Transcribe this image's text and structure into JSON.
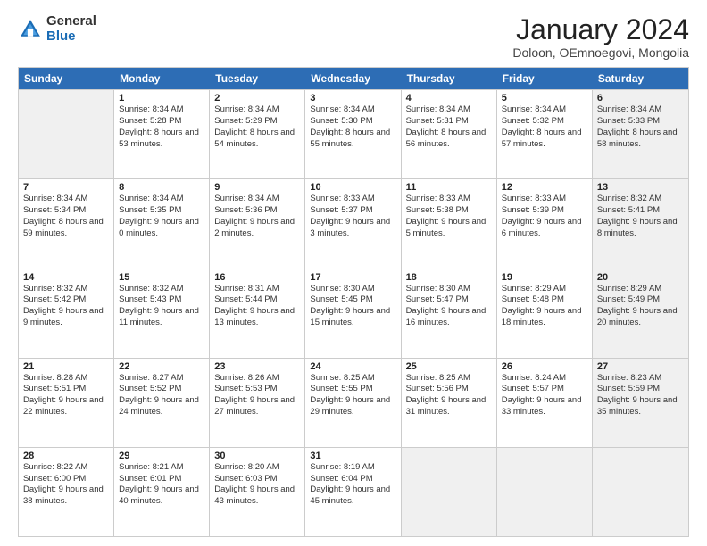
{
  "logo": {
    "general": "General",
    "blue": "Blue"
  },
  "header": {
    "month": "January 2024",
    "location": "Doloon, OEmnoegovi, Mongolia"
  },
  "weekdays": [
    "Sunday",
    "Monday",
    "Tuesday",
    "Wednesday",
    "Thursday",
    "Friday",
    "Saturday"
  ],
  "weeks": [
    [
      {
        "day": "",
        "sunrise": "",
        "sunset": "",
        "daylight": "",
        "shaded": true
      },
      {
        "day": "1",
        "sunrise": "Sunrise: 8:34 AM",
        "sunset": "Sunset: 5:28 PM",
        "daylight": "Daylight: 8 hours and 53 minutes.",
        "shaded": false
      },
      {
        "day": "2",
        "sunrise": "Sunrise: 8:34 AM",
        "sunset": "Sunset: 5:29 PM",
        "daylight": "Daylight: 8 hours and 54 minutes.",
        "shaded": false
      },
      {
        "day": "3",
        "sunrise": "Sunrise: 8:34 AM",
        "sunset": "Sunset: 5:30 PM",
        "daylight": "Daylight: 8 hours and 55 minutes.",
        "shaded": false
      },
      {
        "day": "4",
        "sunrise": "Sunrise: 8:34 AM",
        "sunset": "Sunset: 5:31 PM",
        "daylight": "Daylight: 8 hours and 56 minutes.",
        "shaded": false
      },
      {
        "day": "5",
        "sunrise": "Sunrise: 8:34 AM",
        "sunset": "Sunset: 5:32 PM",
        "daylight": "Daylight: 8 hours and 57 minutes.",
        "shaded": false
      },
      {
        "day": "6",
        "sunrise": "Sunrise: 8:34 AM",
        "sunset": "Sunset: 5:33 PM",
        "daylight": "Daylight: 8 hours and 58 minutes.",
        "shaded": true
      }
    ],
    [
      {
        "day": "7",
        "sunrise": "Sunrise: 8:34 AM",
        "sunset": "Sunset: 5:34 PM",
        "daylight": "Daylight: 8 hours and 59 minutes.",
        "shaded": false
      },
      {
        "day": "8",
        "sunrise": "Sunrise: 8:34 AM",
        "sunset": "Sunset: 5:35 PM",
        "daylight": "Daylight: 9 hours and 0 minutes.",
        "shaded": false
      },
      {
        "day": "9",
        "sunrise": "Sunrise: 8:34 AM",
        "sunset": "Sunset: 5:36 PM",
        "daylight": "Daylight: 9 hours and 2 minutes.",
        "shaded": false
      },
      {
        "day": "10",
        "sunrise": "Sunrise: 8:33 AM",
        "sunset": "Sunset: 5:37 PM",
        "daylight": "Daylight: 9 hours and 3 minutes.",
        "shaded": false
      },
      {
        "day": "11",
        "sunrise": "Sunrise: 8:33 AM",
        "sunset": "Sunset: 5:38 PM",
        "daylight": "Daylight: 9 hours and 5 minutes.",
        "shaded": false
      },
      {
        "day": "12",
        "sunrise": "Sunrise: 8:33 AM",
        "sunset": "Sunset: 5:39 PM",
        "daylight": "Daylight: 9 hours and 6 minutes.",
        "shaded": false
      },
      {
        "day": "13",
        "sunrise": "Sunrise: 8:32 AM",
        "sunset": "Sunset: 5:41 PM",
        "daylight": "Daylight: 9 hours and 8 minutes.",
        "shaded": true
      }
    ],
    [
      {
        "day": "14",
        "sunrise": "Sunrise: 8:32 AM",
        "sunset": "Sunset: 5:42 PM",
        "daylight": "Daylight: 9 hours and 9 minutes.",
        "shaded": false
      },
      {
        "day": "15",
        "sunrise": "Sunrise: 8:32 AM",
        "sunset": "Sunset: 5:43 PM",
        "daylight": "Daylight: 9 hours and 11 minutes.",
        "shaded": false
      },
      {
        "day": "16",
        "sunrise": "Sunrise: 8:31 AM",
        "sunset": "Sunset: 5:44 PM",
        "daylight": "Daylight: 9 hours and 13 minutes.",
        "shaded": false
      },
      {
        "day": "17",
        "sunrise": "Sunrise: 8:30 AM",
        "sunset": "Sunset: 5:45 PM",
        "daylight": "Daylight: 9 hours and 15 minutes.",
        "shaded": false
      },
      {
        "day": "18",
        "sunrise": "Sunrise: 8:30 AM",
        "sunset": "Sunset: 5:47 PM",
        "daylight": "Daylight: 9 hours and 16 minutes.",
        "shaded": false
      },
      {
        "day": "19",
        "sunrise": "Sunrise: 8:29 AM",
        "sunset": "Sunset: 5:48 PM",
        "daylight": "Daylight: 9 hours and 18 minutes.",
        "shaded": false
      },
      {
        "day": "20",
        "sunrise": "Sunrise: 8:29 AM",
        "sunset": "Sunset: 5:49 PM",
        "daylight": "Daylight: 9 hours and 20 minutes.",
        "shaded": true
      }
    ],
    [
      {
        "day": "21",
        "sunrise": "Sunrise: 8:28 AM",
        "sunset": "Sunset: 5:51 PM",
        "daylight": "Daylight: 9 hours and 22 minutes.",
        "shaded": false
      },
      {
        "day": "22",
        "sunrise": "Sunrise: 8:27 AM",
        "sunset": "Sunset: 5:52 PM",
        "daylight": "Daylight: 9 hours and 24 minutes.",
        "shaded": false
      },
      {
        "day": "23",
        "sunrise": "Sunrise: 8:26 AM",
        "sunset": "Sunset: 5:53 PM",
        "daylight": "Daylight: 9 hours and 27 minutes.",
        "shaded": false
      },
      {
        "day": "24",
        "sunrise": "Sunrise: 8:25 AM",
        "sunset": "Sunset: 5:55 PM",
        "daylight": "Daylight: 9 hours and 29 minutes.",
        "shaded": false
      },
      {
        "day": "25",
        "sunrise": "Sunrise: 8:25 AM",
        "sunset": "Sunset: 5:56 PM",
        "daylight": "Daylight: 9 hours and 31 minutes.",
        "shaded": false
      },
      {
        "day": "26",
        "sunrise": "Sunrise: 8:24 AM",
        "sunset": "Sunset: 5:57 PM",
        "daylight": "Daylight: 9 hours and 33 minutes.",
        "shaded": false
      },
      {
        "day": "27",
        "sunrise": "Sunrise: 8:23 AM",
        "sunset": "Sunset: 5:59 PM",
        "daylight": "Daylight: 9 hours and 35 minutes.",
        "shaded": true
      }
    ],
    [
      {
        "day": "28",
        "sunrise": "Sunrise: 8:22 AM",
        "sunset": "Sunset: 6:00 PM",
        "daylight": "Daylight: 9 hours and 38 minutes.",
        "shaded": false
      },
      {
        "day": "29",
        "sunrise": "Sunrise: 8:21 AM",
        "sunset": "Sunset: 6:01 PM",
        "daylight": "Daylight: 9 hours and 40 minutes.",
        "shaded": false
      },
      {
        "day": "30",
        "sunrise": "Sunrise: 8:20 AM",
        "sunset": "Sunset: 6:03 PM",
        "daylight": "Daylight: 9 hours and 43 minutes.",
        "shaded": false
      },
      {
        "day": "31",
        "sunrise": "Sunrise: 8:19 AM",
        "sunset": "Sunset: 6:04 PM",
        "daylight": "Daylight: 9 hours and 45 minutes.",
        "shaded": false
      },
      {
        "day": "",
        "sunrise": "",
        "sunset": "",
        "daylight": "",
        "shaded": true
      },
      {
        "day": "",
        "sunrise": "",
        "sunset": "",
        "daylight": "",
        "shaded": true
      },
      {
        "day": "",
        "sunrise": "",
        "sunset": "",
        "daylight": "",
        "shaded": true
      }
    ]
  ]
}
